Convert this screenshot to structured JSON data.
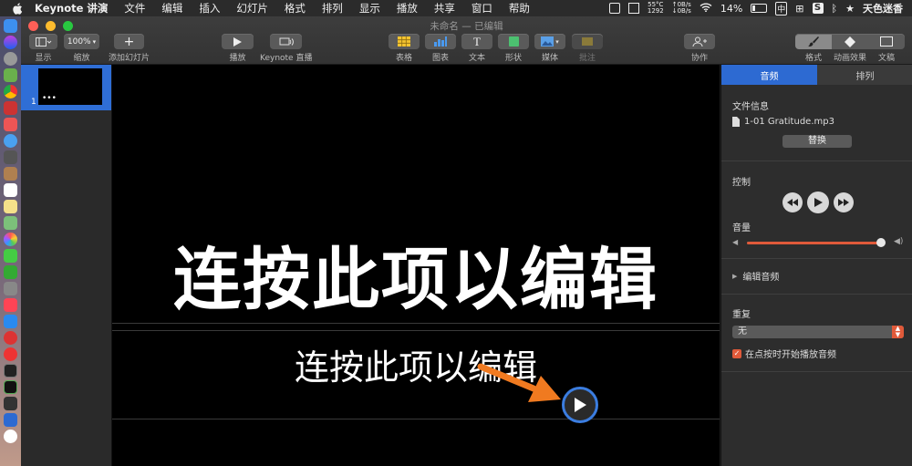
{
  "menubar": {
    "app_name": "Keynote 讲演",
    "items": [
      "文件",
      "编辑",
      "插入",
      "幻灯片",
      "格式",
      "排列",
      "显示",
      "播放",
      "共享",
      "窗口",
      "帮助"
    ],
    "temp": "55°C",
    "fan": "1292",
    "net_up": "0B/s",
    "net_down": "0B/s",
    "battery": "14%",
    "input_method": "中",
    "user_name": "天色迷香"
  },
  "window": {
    "title": "未命名 — 已编辑"
  },
  "toolbar": {
    "view_label": "显示",
    "zoom_value": "100%",
    "zoom_label": "缩放",
    "add_slide_label": "添加幻灯片",
    "play_label": "播放",
    "keynote_live_label": "Keynote 直播",
    "table_label": "表格",
    "chart_label": "图表",
    "text_label": "文本",
    "shape_label": "形状",
    "media_label": "媒体",
    "comment_label": "批注",
    "collaborate_label": "协作",
    "format_label": "格式",
    "animate_label": "动画效果",
    "document_label": "文稿"
  },
  "navigator": {
    "slide_number": "1"
  },
  "slide": {
    "title": "连按此项以编辑",
    "subtitle": "连按此项以编辑"
  },
  "inspector": {
    "tab_audio": "音频",
    "tab_arrange": "排列",
    "file_info_label": "文件信息",
    "file_name": "1-01 Gratitude.mp3",
    "replace_button": "替换",
    "controls_label": "控制",
    "volume_label": "音量",
    "volume_level": 0.98,
    "edit_audio_label": "编辑音频",
    "repeat_label": "重复",
    "repeat_value": "无",
    "start_on_click_label": "在点按时开始播放音频",
    "start_on_click_checked": true,
    "accent_color": "#e05a3a"
  }
}
